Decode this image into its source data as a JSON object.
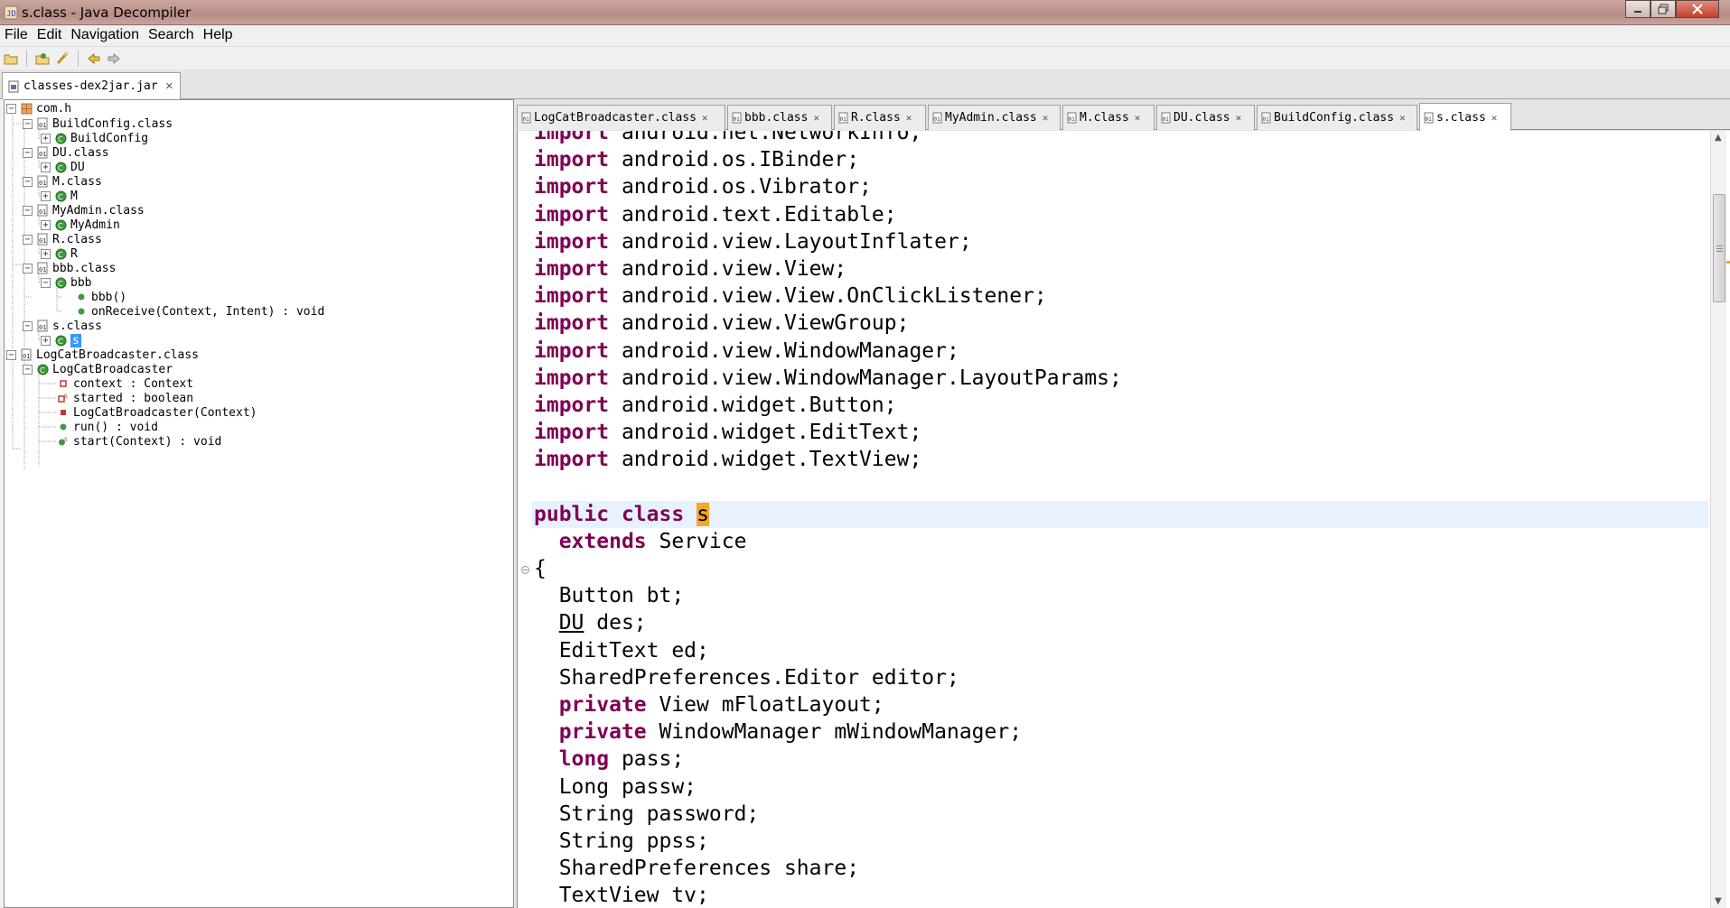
{
  "window": {
    "title": "s.class - Java Decompiler",
    "buttons": {
      "minimize": "minimize-icon",
      "maximize": "maximize-icon",
      "close": "close-icon"
    }
  },
  "menu": [
    "File",
    "Edit",
    "Navigation",
    "Search",
    "Help"
  ],
  "toolbar": {
    "icons": [
      "open-file-icon",
      "open-type-icon",
      "open-type-hierarchy-icon",
      "back-icon",
      "forward-icon"
    ]
  },
  "jar_tab": {
    "label": "classes-dex2jar.jar"
  },
  "tree": {
    "package": "com.h",
    "nodes": [
      {
        "label": "BuildConfig.class"
      },
      {
        "label": "BuildConfig"
      },
      {
        "label": "DU.class"
      },
      {
        "label": "DU"
      },
      {
        "label": "M.class"
      },
      {
        "label": "M"
      },
      {
        "label": "MyAdmin.class"
      },
      {
        "label": "MyAdmin"
      },
      {
        "label": "R.class"
      },
      {
        "label": "R"
      },
      {
        "label": "bbb.class"
      },
      {
        "label": "bbb"
      },
      {
        "label": "bbb()"
      },
      {
        "label": "onReceive(Context, Intent) : void"
      },
      {
        "label": "s.class"
      },
      {
        "label": "s"
      },
      {
        "label": "LogCatBroadcaster.class"
      },
      {
        "label": "LogCatBroadcaster"
      },
      {
        "label": "context : Context"
      },
      {
        "label": "started : boolean"
      },
      {
        "label": "LogCatBroadcaster(Context)"
      },
      {
        "label": "run() : void"
      },
      {
        "label": "start(Context) : void"
      }
    ]
  },
  "editor_tabs": [
    {
      "label": "LogCatBroadcaster.class"
    },
    {
      "label": "bbb.class"
    },
    {
      "label": "R.class"
    },
    {
      "label": "MyAdmin.class"
    },
    {
      "label": "M.class"
    },
    {
      "label": "DU.class"
    },
    {
      "label": "BuildConfig.class"
    },
    {
      "label": "s.class",
      "active": true
    }
  ],
  "code": {
    "imports": [
      "android.net.NetworkInfo;",
      "android.os.IBinder;",
      "android.os.Vibrator;",
      "android.text.Editable;",
      "android.view.LayoutInflater;",
      "android.view.View;",
      "android.view.View.OnClickListener;",
      "android.view.ViewGroup;",
      "android.view.WindowManager;",
      "android.view.WindowManager.LayoutParams;",
      "android.widget.Button;",
      "android.widget.EditText;",
      "android.widget.TextView;"
    ],
    "import_kw": "import",
    "class_decl": {
      "kw1": "public",
      "kw2": "class",
      "name": "s"
    },
    "extends": {
      "kw": "extends",
      "type": "Service"
    },
    "open_brace": "{",
    "fields": {
      "f1": "Button bt;",
      "f2_type": "DU",
      "f2_rest": " des;",
      "f3": "EditText ed;",
      "f4": "SharedPreferences.Editor editor;",
      "f5_kw": "private",
      "f5_rest": " View mFloatLayout;",
      "f6_kw": "private",
      "f6_rest": " WindowManager mWindowManager;",
      "f7_kw": "long",
      "f7_rest": " pass;",
      "f8": "Long passw;",
      "f9": "String password;",
      "f10": "String ppss;",
      "f11": "SharedPreferences share;",
      "f12": "TextView tv;"
    }
  },
  "colors": {
    "keyword": "#7f0055",
    "highlight": "#f5a623",
    "current_line": "#e8f2fe",
    "selection": "#3399ff"
  }
}
